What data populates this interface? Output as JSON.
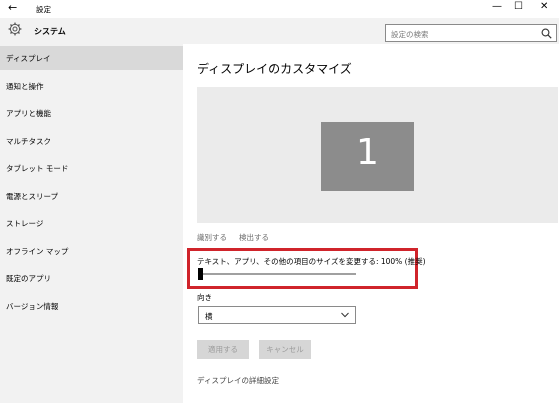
{
  "window": {
    "back_icon": "arrow-left-icon",
    "title": "設定",
    "minimize_icon": "minimize-icon",
    "maximize_icon": "maximize-icon",
    "close_icon": "close-icon"
  },
  "sidebar": {
    "header": "システム",
    "header_icon": "gear-icon",
    "items": [
      {
        "label": "ディスプレイ",
        "active": true
      },
      {
        "label": "通知と操作"
      },
      {
        "label": "アプリと機能"
      },
      {
        "label": "マルチタスク"
      },
      {
        "label": "タブレット モード"
      },
      {
        "label": "電源とスリープ"
      },
      {
        "label": "ストレージ"
      },
      {
        "label": "オフライン マップ"
      },
      {
        "label": "既定のアプリ"
      },
      {
        "label": "バージョン情報"
      }
    ]
  },
  "search": {
    "placeholder": "設定の検索",
    "icon": "search-icon"
  },
  "main": {
    "title": "ディスプレイのカスタマイズ",
    "monitor_number": "1",
    "identify_link": "識別する",
    "detect_link": "検出する",
    "scale_label": "テキスト、アプリ、その他の項目のサイズを変更する: 100% (推奨)",
    "scale_value_percent": 0,
    "orientation_label": "向き",
    "orientation_value": "横",
    "apply_button": "適用する",
    "cancel_button": "キャンセル",
    "advanced_link": "ディスプレイの詳細設定"
  },
  "colors": {
    "highlight": "#d0242b",
    "sidebar_bg": "#f2f2f2",
    "monitor": "#8c8c8c"
  }
}
